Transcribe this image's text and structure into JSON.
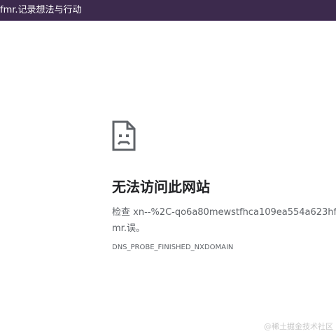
{
  "tab": {
    "title": "fmr.记录想法与行动"
  },
  "error": {
    "icon": "sad-page-icon",
    "heading": "无法访问此网站",
    "message": "检查 xn--%2C-qo6a80mewstfhca109ea554a623hfmr.误。",
    "code": "DNS_PROBE_FINISHED_NXDOMAIN"
  },
  "watermark": "@稀土掘金技术社区",
  "colors": {
    "tabbar": "#3c2a4d",
    "heading": "#202124",
    "body_text": "#5f6368"
  }
}
